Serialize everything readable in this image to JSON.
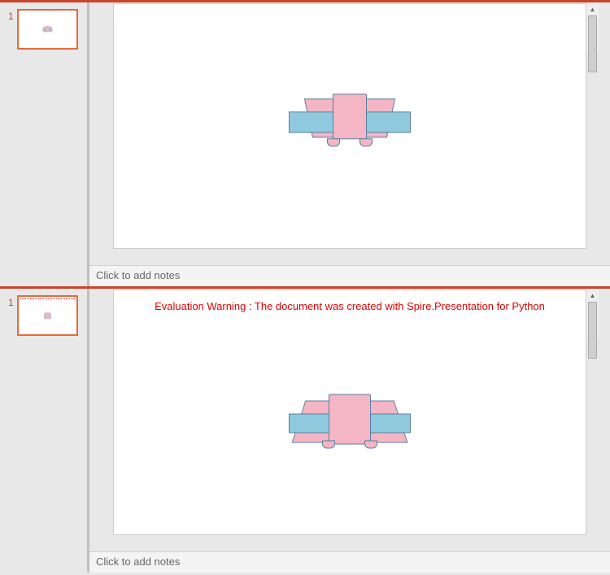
{
  "panels": [
    {
      "slide_number": "1",
      "notes_placeholder": "Click to add notes",
      "warning": null,
      "ribbon_variant": "a"
    },
    {
      "slide_number": "1",
      "notes_placeholder": "Click to add notes",
      "warning": "Evaluation Warning : The document was created with Spire.Presentation for Python",
      "ribbon_variant": "b"
    }
  ],
  "colors": {
    "accent": "#c8442a",
    "ribbon_pink": "#f4b6c4",
    "ribbon_blue": "#8fc9de",
    "ribbon_stroke": "#5a7ea0",
    "warning_text": "#e00000"
  },
  "scroll_glyphs": {
    "up": "▲",
    "down": "▼",
    "prev": "⯭",
    "next": "⯯"
  }
}
